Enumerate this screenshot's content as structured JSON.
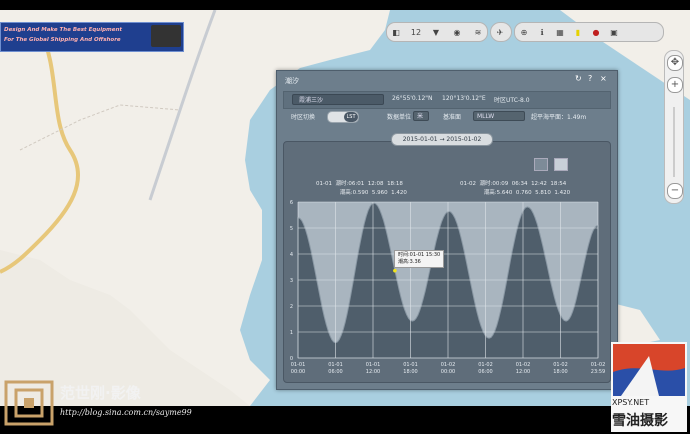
{
  "banner": {
    "line1": "Design And Make The Best Equipment",
    "line2": "For The Global Shipping And Offshore"
  },
  "dialog": {
    "title": "潮汐",
    "station": "霞浦三沙",
    "lat": "26°55'0.12\"N",
    "lon": "120°13'0.12\"E",
    "timezone": "时区UTC-8.0",
    "tz_switch_label": "时区切换",
    "tz_toggle_value": "LST",
    "unit_label": "数据单位",
    "unit_value": "米",
    "datum_label": "基准面",
    "datum_value": "MLLW",
    "datum_note": "超平海平面：1.49m",
    "date_range": "2015-01-01  →  2015-01-02"
  },
  "tide_info": {
    "day1": {
      "date": "01-01",
      "times_label": "潮时:06:01",
      "times": [
        "12:08",
        "18:18"
      ],
      "heights_label": "潮高:0.590",
      "heights": [
        "5.960",
        "1.420"
      ]
    },
    "day2": {
      "date": "01-02",
      "times_label": "潮时:00:09",
      "times": [
        "06:34",
        "12:42",
        "18:54"
      ],
      "heights_label": "潮高:5.640",
      "heights": [
        "0.760",
        "5.810",
        "1.420"
      ]
    }
  },
  "tooltip": {
    "line1": "时间:01-01 15:30",
    "line2": "潮高:3.36"
  },
  "chart_data": {
    "type": "area",
    "ylim": [
      0,
      6
    ],
    "yticks": [
      "0",
      "1",
      "2",
      "3",
      "4",
      "5",
      "6"
    ],
    "xticks": [
      [
        "01-01",
        "00:00"
      ],
      [
        "01-01",
        "06:00"
      ],
      [
        "01-01",
        "12:00"
      ],
      [
        "01-01",
        "18:00"
      ],
      [
        "01-02",
        "00:00"
      ],
      [
        "01-02",
        "06:00"
      ],
      [
        "01-02",
        "12:00"
      ],
      [
        "01-02",
        "18:00"
      ],
      [
        "01-02",
        "23:59"
      ]
    ],
    "extrema": [
      {
        "t": "01-01 00:00",
        "h": 5.4
      },
      {
        "t": "01-01 06:01",
        "h": 0.59
      },
      {
        "t": "01-01 12:08",
        "h": 5.96
      },
      {
        "t": "01-01 18:18",
        "h": 1.42
      },
      {
        "t": "01-02 00:09",
        "h": 5.64
      },
      {
        "t": "01-02 06:34",
        "h": 0.76
      },
      {
        "t": "01-02 12:42",
        "h": 5.81
      },
      {
        "t": "01-02 18:54",
        "h": 1.42
      },
      {
        "t": "01-02 23:59",
        "h": 5.1
      }
    ],
    "marker": {
      "t": "01-01 15:30",
      "h": 3.36
    },
    "fill_color": "#4f5e6b",
    "line_color": "#8a98a4",
    "grid": true
  },
  "toolbar": {
    "layer_count": "12",
    "icons": [
      "layer-icon",
      "filter-icon",
      "eye-icon",
      "wind-icon",
      "compass-icon",
      "globe-icon",
      "info-icon",
      "calendar-icon",
      "flag-icon",
      "record-icon",
      "grid-icon"
    ]
  },
  "watermark": {
    "brand": "范世刚·影像",
    "blog": "http://blog.sina.com.cn/sayme99",
    "site": "XPSY.NET",
    "site_cn": "雪油摄影"
  }
}
